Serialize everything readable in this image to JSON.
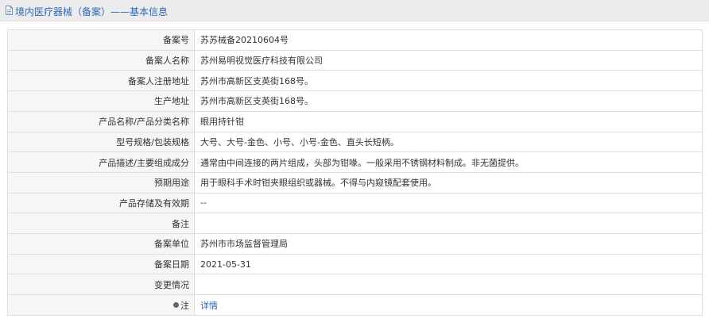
{
  "header": {
    "title": "境内医疗器械（备案）——基本信息"
  },
  "rows": [
    {
      "label": "备案号",
      "value": "苏苏械备20210604号"
    },
    {
      "label": "备案人名称",
      "value": "苏州易明视觉医疗科技有限公司"
    },
    {
      "label": "备案人注册地址",
      "value": "苏州市高新区支英街168号。"
    },
    {
      "label": "生产地址",
      "value": "苏州市高新区支英街168号。"
    },
    {
      "label": "产品名称/产品分类名称",
      "value": "眼用持针钳"
    },
    {
      "label": "型号规格/包装规格",
      "value": "大号、大号-金色、小号、小号-金色、直头长短柄。"
    },
    {
      "label": "产品描述/主要组成成分",
      "value": "通常由中间连接的两片组成，头部为钳喙。一般采用不锈钢材料制成。非无菌提供。"
    },
    {
      "label": "预期用途",
      "value": "用于眼科手术时钳夹眼组织或器械。不得与内窥镜配套使用。"
    },
    {
      "label": "产品存储及有效期",
      "value": "--"
    },
    {
      "label": "备注",
      "value": ""
    },
    {
      "label": "备案单位",
      "value": "苏州市市场监督管理局"
    },
    {
      "label": "备案日期",
      "value": "2021-05-31"
    },
    {
      "label": "变更情况",
      "value": ""
    },
    {
      "label": "注",
      "value": "详情"
    }
  ],
  "colors": {
    "title_bar_bg": "#ececec",
    "title_text": "#2a6ab3",
    "link": "#2a6ab3",
    "border": "#dedede",
    "label_bg": "#f6f6f6"
  },
  "icons": {
    "title_icon": "document-icon",
    "note_icon": "pin-icon"
  }
}
